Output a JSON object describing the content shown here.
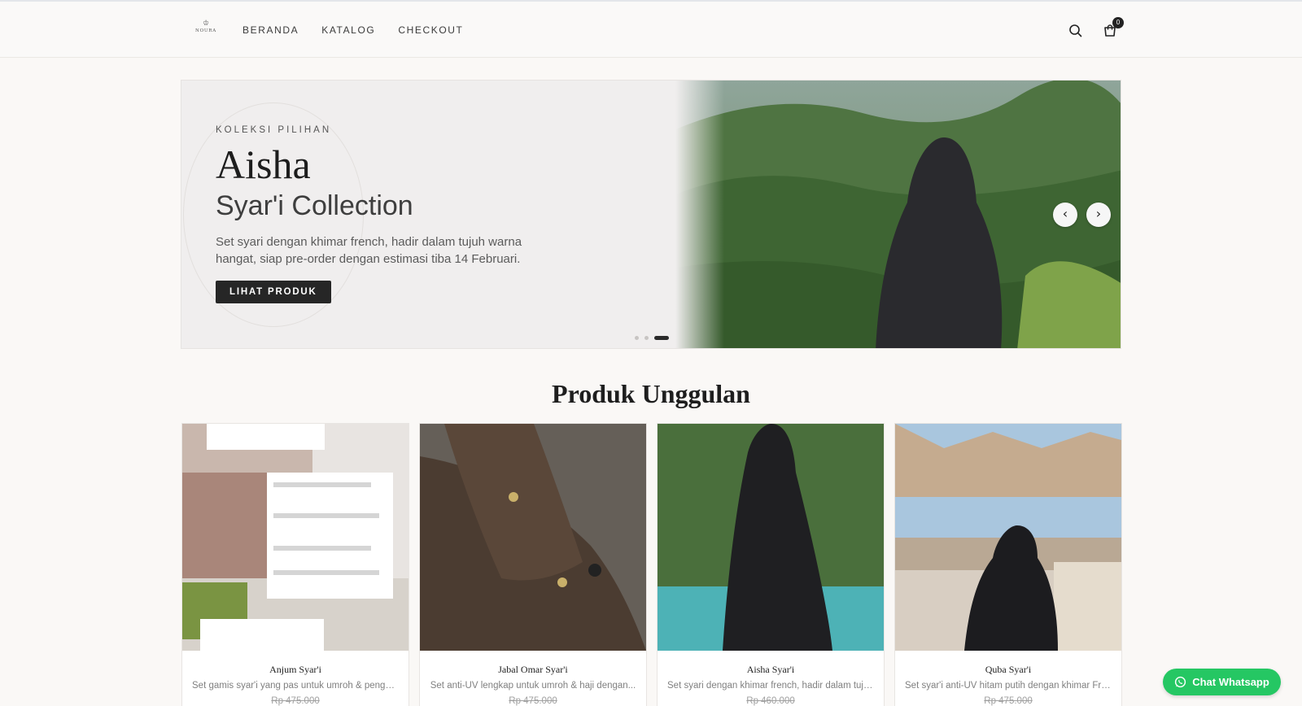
{
  "header": {
    "logo": {
      "mark": "♔",
      "word": "NOURA"
    },
    "nav": [
      "BERANDA",
      "KATALOG",
      "CHECKOUT"
    ],
    "cart_count": "0",
    "icons": {
      "search": "search-icon",
      "cart": "shopping-bag-icon"
    }
  },
  "hero": {
    "eyebrow": "KOLEKSI PILIHAN",
    "title": "Aisha",
    "subtitle": "Syar'i Collection",
    "description": "Set syari dengan khimar french, hadir dalam tujuh warna hangat, siap pre-order dengan estimasi tiba 14 Februari.",
    "button": "LIHAT PRODUK",
    "prev_arrow": "‹",
    "next_arrow": "›",
    "slides": 3,
    "active_slide": 3
  },
  "section": {
    "title": "Produk Unggulan"
  },
  "products": [
    {
      "name": "Anjum Syar'i",
      "desc": "Set gamis syar'i yang pas untuk umroh & pengajian,...",
      "price": "Rp 475.000"
    },
    {
      "name": "Jabal Omar Syar'i",
      "desc": "Set anti-UV lengkap untuk umroh & haji dengan...",
      "price": "Rp 475.000"
    },
    {
      "name": "Aisha Syar'i",
      "desc": "Set syari dengan khimar french, hadir dalam tujuh...",
      "price": "Rp 460.000"
    },
    {
      "name": "Quba Syar'i",
      "desc": "Set syar'i anti-UV hitam putih dengan khimar French...",
      "price": "Rp 475.000"
    }
  ],
  "chat": {
    "label": "Chat Whatsapp",
    "icon": "whatsapp-icon"
  },
  "colors": {
    "accent": "#262626",
    "whatsapp": "#25c763",
    "background": "#faf8f6"
  }
}
